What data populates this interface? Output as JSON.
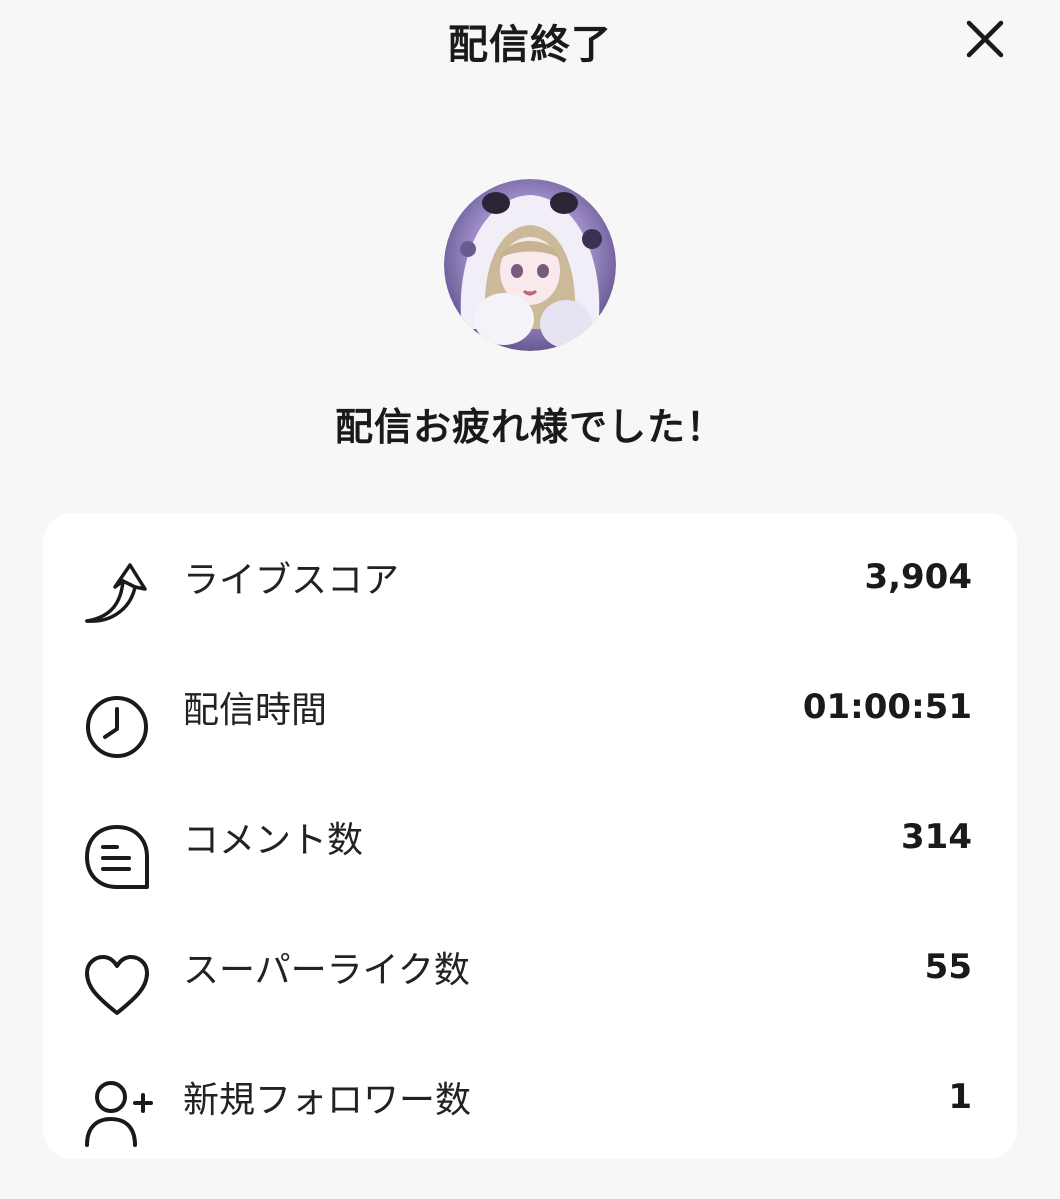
{
  "header": {
    "title": "配信終了"
  },
  "message": "配信お疲れ様でした！",
  "stats": [
    {
      "icon": "trending-arrow-icon",
      "label": "ライブスコア",
      "value": "3,904"
    },
    {
      "icon": "clock-icon",
      "label": "配信時間",
      "value": "01:00:51"
    },
    {
      "icon": "comment-icon",
      "label": "コメント数",
      "value": "314"
    },
    {
      "icon": "heart-icon",
      "label": "スーパーライク数",
      "value": "55"
    },
    {
      "icon": "add-user-icon",
      "label": "新規フォロワー数",
      "value": "1"
    }
  ],
  "colors": {
    "background": "#f7f7f7",
    "card": "#ffffff",
    "text": "#1a1a1a",
    "avatar_tint": "#8f84b8"
  }
}
